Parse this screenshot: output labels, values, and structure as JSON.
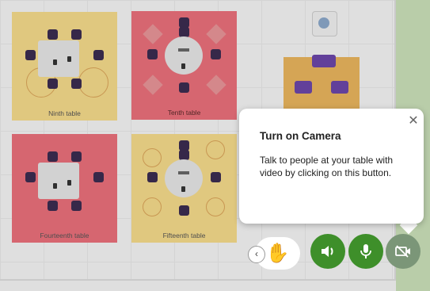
{
  "tables": [
    {
      "label": "Ninth table"
    },
    {
      "label": "Tenth table"
    },
    {
      "label": "Fourteenth table"
    },
    {
      "label": "Fifteenth table"
    }
  ],
  "popover": {
    "title": "Turn on Camera",
    "body": "Talk to people at your table with video by clicking on this button.",
    "close_icon": "close-icon"
  },
  "controls": {
    "collapse_icon": "chevron-left-icon",
    "hand_icon": "raise-hand-icon",
    "speaker_icon": "speaker-icon",
    "mic_icon": "microphone-icon",
    "camera_icon": "camera-off-icon",
    "colors": {
      "active": "#3e8f2a",
      "inactive": "#7b9678"
    }
  }
}
